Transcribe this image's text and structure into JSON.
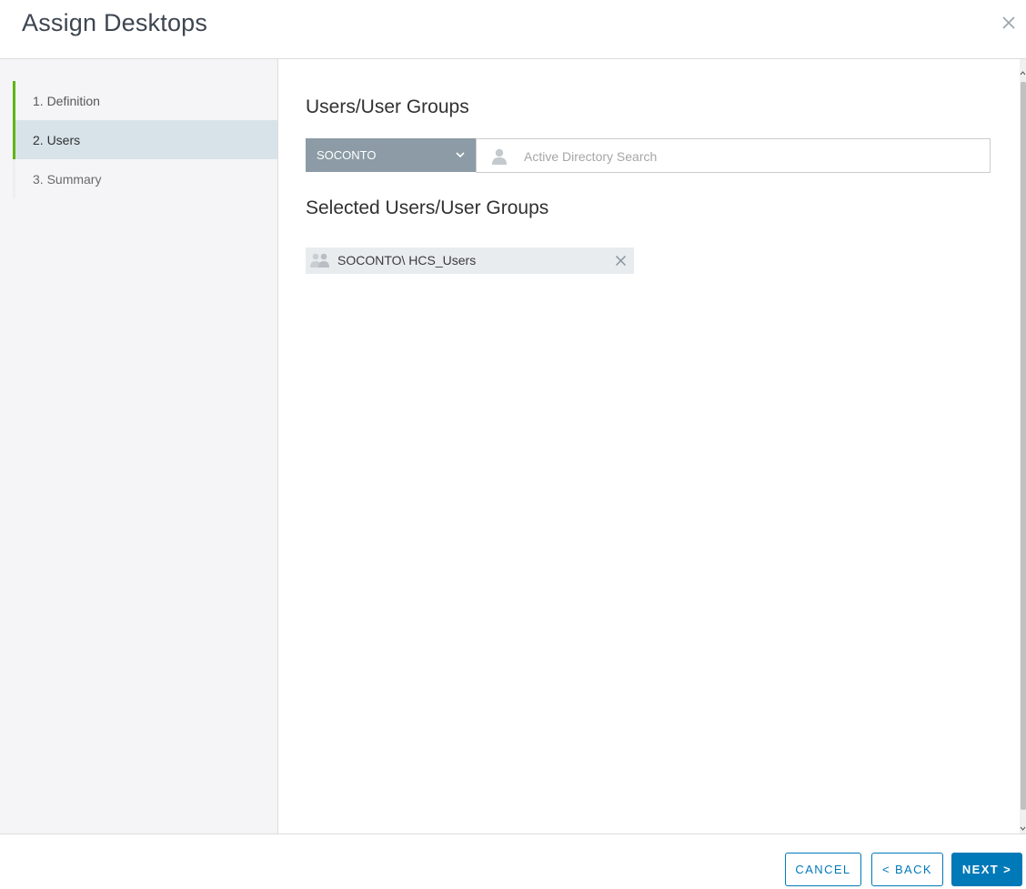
{
  "dialog": {
    "title": "Assign Desktops",
    "close_icon": "close-icon"
  },
  "wizard": {
    "steps": [
      {
        "label": "1. Definition",
        "state": "completed"
      },
      {
        "label": "2. Users",
        "state": "active"
      },
      {
        "label": "3. Summary",
        "state": "pending"
      }
    ]
  },
  "users_section": {
    "heading": "Users/User Groups",
    "domain_selected": "SOCONTO",
    "search": {
      "placeholder": "Active Directory Search",
      "value": ""
    }
  },
  "selected_section": {
    "heading": "Selected Users/User Groups",
    "items": [
      {
        "label": "SOCONTO\\ HCS_Users",
        "icon": "user-group-icon"
      }
    ]
  },
  "footer": {
    "cancel_label": "CANCEL",
    "back_label": "< BACK",
    "next_label": "NEXT >"
  },
  "colors": {
    "accent": "#0079b8",
    "step_complete": "#60b515",
    "active_step_bg": "#d8e3e9",
    "domain_select_bg": "#8c9ba5"
  }
}
